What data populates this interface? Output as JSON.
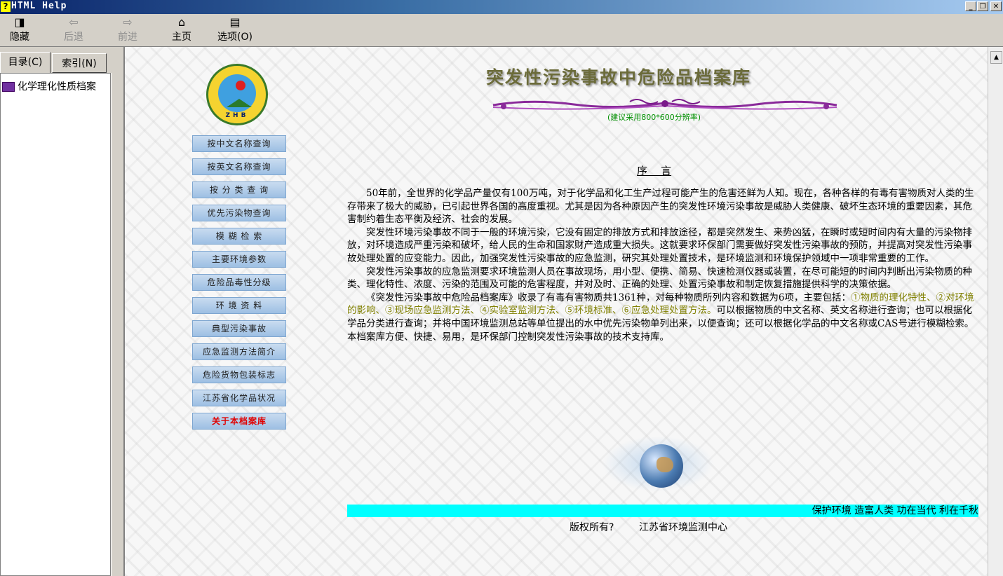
{
  "window": {
    "title": "HTML Help"
  },
  "toolbar": {
    "hide": "隐藏",
    "back": "后退",
    "forward": "前进",
    "home": "主页",
    "options": "选项(O)"
  },
  "left_pane": {
    "tabs": [
      "目录(C)",
      "索引(N)"
    ],
    "tree_item": "化学理化性质档案"
  },
  "content": {
    "title": "突发性污染事故中危险品档案库",
    "resolution_note": "(建议采用800*600分辨率)",
    "preface_heading": "序    言",
    "nav_buttons": [
      "按中文名称查询",
      "按英文名称查询",
      "按 分 类 查 询",
      "优先污染物查询",
      "模 糊 检 索",
      "主要环境参数",
      "危险品毒性分级",
      "环 境 资 料",
      "典型污染事故",
      "应急监测方法简介",
      "危险货物包装标志",
      "江苏省化学品状况",
      "关于本档案库"
    ],
    "logo_text": "ZHB",
    "paragraphs": [
      "50年前，全世界的化学品产量仅有100万吨，对于化学品和化工生产过程可能产生的危害还鲜为人知。现在，各种各样的有毒有害物质对人类的生存带来了极大的威胁，已引起世界各国的高度重视。尤其是因为各种原因产生的突发性环境污染事故是威胁人类健康、破坏生态环境的重要因素，其危害制约着生态平衡及经济、社会的发展。",
      "突发性环境污染事故不同于一般的环境污染，它没有固定的排放方式和排放途径，都是突然发生、来势凶猛，在瞬时或短时间内有大量的污染物排放，对环境造成严重污染和破坏，给人民的生命和国家财产造成重大损失。这就要求环保部门需要做好突发性污染事故的预防，并提高对突发性污染事故处理处置的应变能力。因此，加强突发性污染事故的应急监测，研究其处理处置技术，是环境监测和环境保护领域中一项非常重要的工作。",
      "突发性污染事故的应急监测要求环境监测人员在事故现场，用小型、便携、简易、快速检测仪器或装置，在尽可能短的时间内判断出污染物质的种类、理化特性、浓度、污染的范围及可能的危害程度，并对及时、正确的处理、处置污染事故和制定恢复措施提供科学的决策依据。"
    ],
    "p4_pre": "《突发性污染事故中危险品档案库》收录了有毒有害物质共1361种，对每种物质所列内容和数据为6项，主要包括：",
    "p4_highlight": "①物质的理化特性、②对环境的影响、③现场应急监测方法、④实验室监测方法、⑤环境标准、⑥应急处理处置方法。",
    "p4_post": "可以根据物质的中文名称、英文名称进行查询；也可以根据化学品分类进行查询；并将中国环境监测总站等单位提出的水中优先污染物单列出来，以便查询；还可以根据化学品的中文名称或CAS号进行模糊检索。本档案库方便、快捷、易用，是环保部门控制突发性污染事故的技术支持库。",
    "marquee": "保护环境 造富人类 功在当代 利在千秋",
    "copyright": "版权所有?        江苏省环境监测中心"
  },
  "colors": {
    "highlight": "#808000",
    "marquee_bg": "#00ffff",
    "res_note": "#009000",
    "about_btn": "#e00000"
  }
}
